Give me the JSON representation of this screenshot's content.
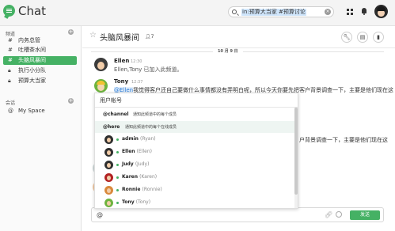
{
  "app": {
    "title": "Chat"
  },
  "search": {
    "query": "in:预算大当家 #预算讨论"
  },
  "sidebar": {
    "channels_label": "频道",
    "channels": [
      {
        "icon": "hash-icon",
        "label": "内务总管",
        "active": false
      },
      {
        "icon": "hash-icon",
        "label": "吐槽茶水间",
        "active": false
      },
      {
        "icon": "hash-icon",
        "label": "头脑风暴间",
        "active": true
      },
      {
        "icon": "lock-icon",
        "label": "执行小分队",
        "active": false
      },
      {
        "icon": "lock-icon",
        "label": "预算大当家",
        "active": false
      }
    ],
    "sessions_label": "会话",
    "sessions": [
      {
        "icon": "at-icon",
        "label": "My Space"
      }
    ]
  },
  "channel": {
    "name": "头脑风暴间",
    "member_count": "7"
  },
  "messages": {
    "date_divider": "10 月 9 日",
    "items": [
      {
        "user": "Ellen",
        "time": "12:30",
        "text": "Ellen,Tony 已加入此频道。"
      },
      {
        "user": "Tony",
        "time": "12:37",
        "mention": "@Ellen",
        "text": "我觉得客户还自己要做什么事情都没有弄明白呢，所以今天你要先把客户背景调查一下，主要是他们现在这",
        "continuation": "户背景调查一下，主要是他们现在这"
      }
    ]
  },
  "popup": {
    "title": "用户帐号",
    "special": [
      {
        "key": "@channel",
        "desc": "通知此频道中的每个成员"
      },
      {
        "key": "@here",
        "desc": "通知此频道中的每个在线成员"
      }
    ],
    "users": [
      {
        "username": "admin",
        "realname": "(Ryan)"
      },
      {
        "username": "Ellen",
        "realname": "(Ellen)"
      },
      {
        "username": "Judy",
        "realname": "(Judy)"
      },
      {
        "username": "Karen",
        "realname": "(Karen)"
      },
      {
        "username": "Ronnie",
        "realname": "(Ronnie)"
      },
      {
        "username": "Tony",
        "realname": "(Tony)"
      }
    ]
  },
  "composer": {
    "send_label": "发送"
  },
  "colors": {
    "accent": "#45b164",
    "mention": "#2a7bd6"
  }
}
